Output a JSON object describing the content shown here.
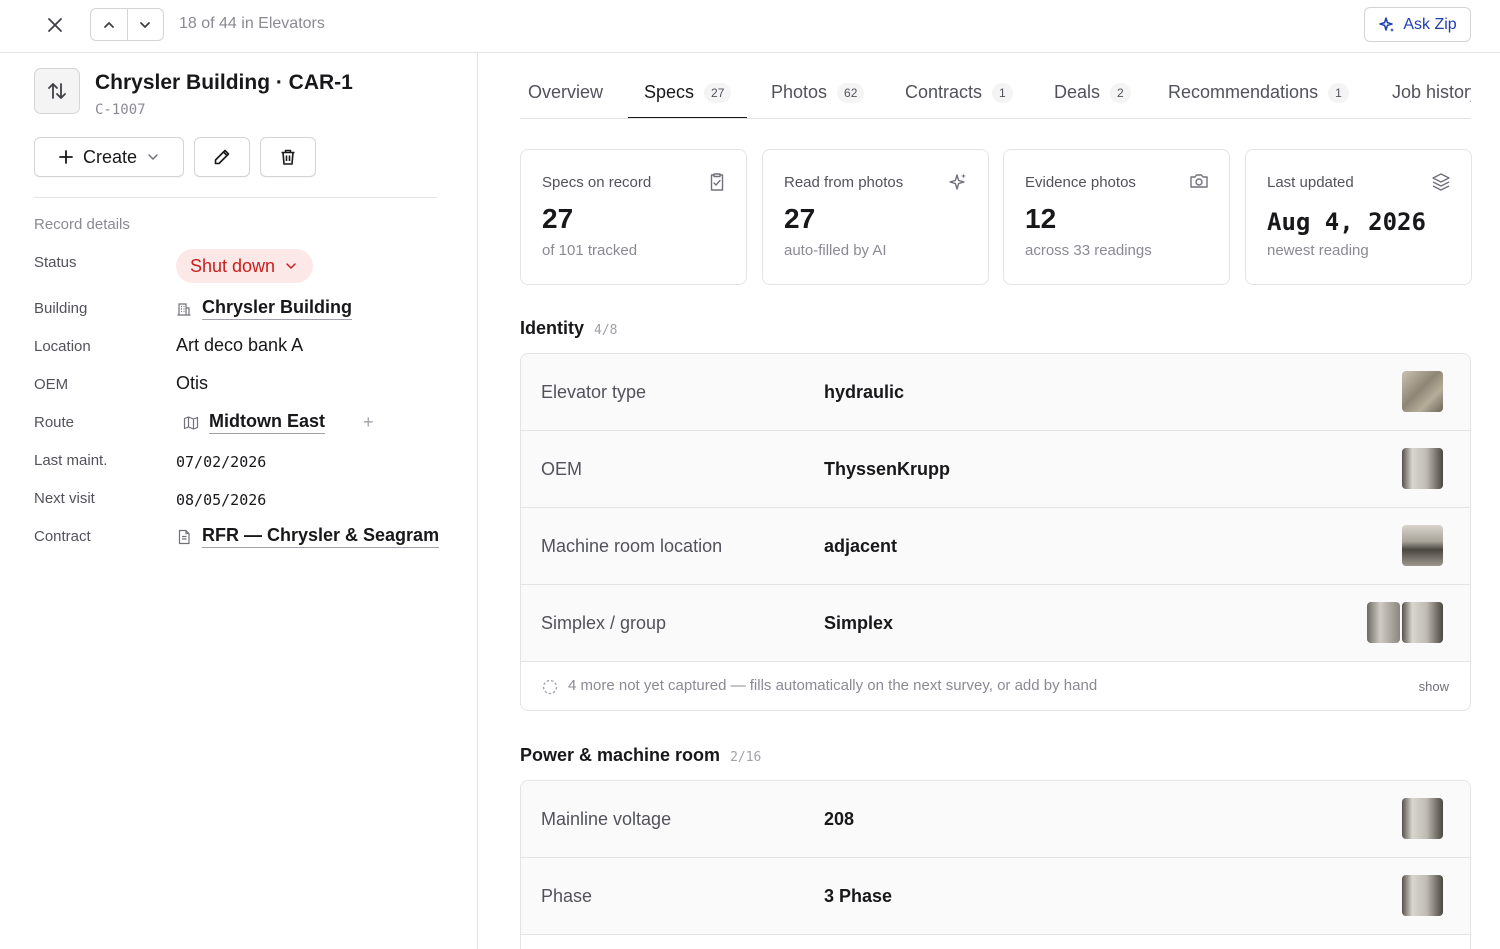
{
  "topbar": {
    "counter": "18 of 44 in Elevators",
    "ask_zip": "Ask Zip"
  },
  "record": {
    "title": "Chrysler Building · CAR-1",
    "code": "C-1007",
    "create_label": "Create"
  },
  "details": {
    "section_label": "Record details",
    "fields": [
      {
        "label": "Status",
        "value": "Shut down"
      },
      {
        "label": "Building",
        "value": "Chrysler Building"
      },
      {
        "label": "Location",
        "value": "Art deco bank A"
      },
      {
        "label": "OEM",
        "value": "Otis"
      },
      {
        "label": "Route",
        "value": "Midtown East",
        "add": "+"
      },
      {
        "label": "Last maint.",
        "value": "07/02/2026"
      },
      {
        "label": "Next visit",
        "value": "08/05/2026"
      },
      {
        "label": "Contract",
        "value": "RFR — Chrysler & Seagram"
      }
    ]
  },
  "tabs": [
    {
      "label": "Overview",
      "count": ""
    },
    {
      "label": "Specs",
      "count": "27"
    },
    {
      "label": "Photos",
      "count": "62"
    },
    {
      "label": "Contracts",
      "count": "1"
    },
    {
      "label": "Deals",
      "count": "2"
    },
    {
      "label": "Recommendations",
      "count": "1"
    },
    {
      "label": "Job history",
      "count": ""
    }
  ],
  "stats": [
    {
      "label": "Specs on record",
      "value": "27",
      "sub": "of 101 tracked",
      "icon": "clipboard-check-icon"
    },
    {
      "label": "Read from photos",
      "value": "27",
      "sub": "auto-filled by AI",
      "icon": "sparkles-icon"
    },
    {
      "label": "Evidence photos",
      "value": "12",
      "sub": "across 33 readings",
      "icon": "camera-icon"
    },
    {
      "label": "Last updated",
      "value": "Aug 4, 2026",
      "sub": "newest reading",
      "icon": "layers-icon"
    }
  ],
  "groups": [
    {
      "title": "Identity",
      "count": "4/8",
      "rows": [
        {
          "name": "Elevator type",
          "value": "hydraulic"
        },
        {
          "name": "OEM",
          "value": "ThyssenKrupp"
        },
        {
          "name": "Machine room location",
          "value": "adjacent"
        },
        {
          "name": "Simplex / group",
          "value": "Simplex"
        }
      ],
      "missing": "4 more not yet captured — fills automatically on the next survey, or add by hand",
      "show": "show"
    },
    {
      "title": "Power & machine room",
      "count": "2/16",
      "rows": [
        {
          "name": "Mainline voltage",
          "value": "208"
        },
        {
          "name": "Phase",
          "value": "3 Phase"
        }
      ]
    }
  ],
  "colors": {
    "accent": "#1e40af",
    "status_bg": "#fde8e8",
    "status_text": "#c81e1e"
  }
}
